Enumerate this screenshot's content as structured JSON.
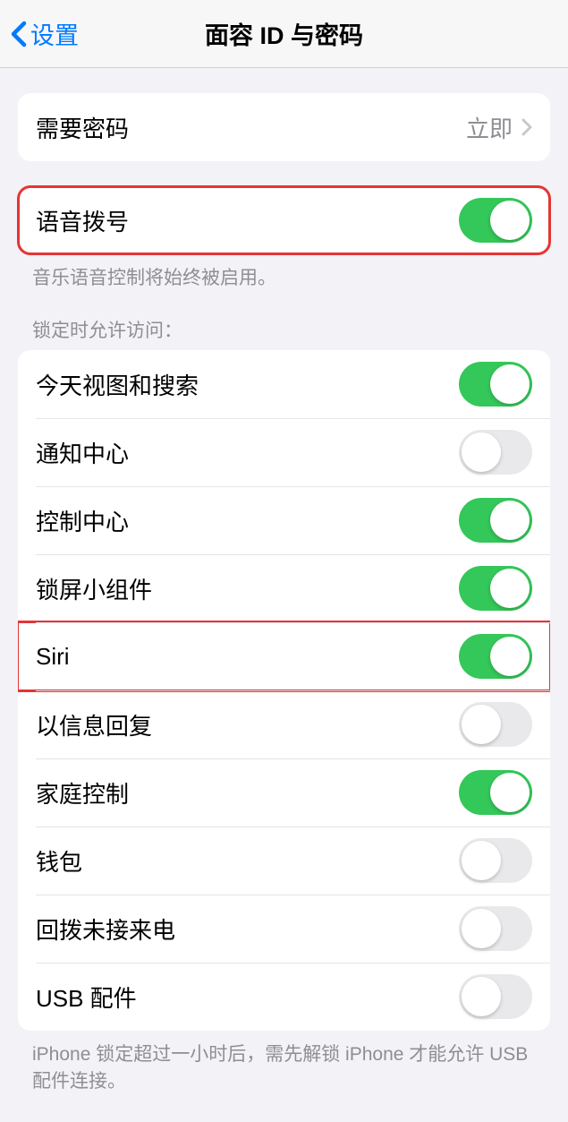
{
  "nav": {
    "back_label": "设置",
    "title": "面容 ID 与密码"
  },
  "passcode_group": {
    "require_passcode": {
      "label": "需要密码",
      "value": "立即"
    }
  },
  "voice_dial_group": {
    "voice_dial": {
      "label": "语音拨号",
      "on": true
    },
    "footer": "音乐语音控制将始终被启用。"
  },
  "lock_access": {
    "header": "锁定时允许访问：",
    "items": [
      {
        "label": "今天视图和搜索",
        "on": true
      },
      {
        "label": "通知中心",
        "on": false
      },
      {
        "label": "控制中心",
        "on": true
      },
      {
        "label": "锁屏小组件",
        "on": true
      },
      {
        "label": "Siri",
        "on": true,
        "highlighted": true
      },
      {
        "label": "以信息回复",
        "on": false
      },
      {
        "label": "家庭控制",
        "on": true
      },
      {
        "label": "钱包",
        "on": false
      },
      {
        "label": "回拨未接来电",
        "on": false
      },
      {
        "label": "USB 配件",
        "on": false
      }
    ],
    "footer": "iPhone 锁定超过一小时后，需先解锁 iPhone 才能允许 USB 配件连接。"
  }
}
